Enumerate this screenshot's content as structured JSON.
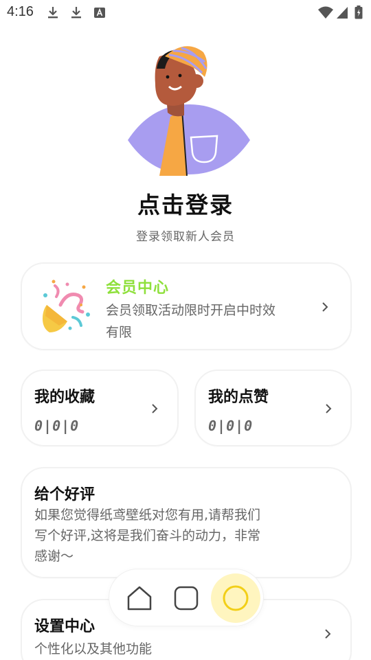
{
  "status_bar": {
    "time": "4:16",
    "icons": [
      "download-icon",
      "download-icon",
      "font-icon",
      "wifi-icon",
      "signal-icon",
      "battery-icon"
    ]
  },
  "profile": {
    "title": "点击登录",
    "subtitle": "登录领取新人会员"
  },
  "member_card": {
    "title": "会员中心",
    "description": "会员领取活动限时开启中时效有限",
    "title_color": "#8fe03c"
  },
  "stats": [
    {
      "title": "我的收藏",
      "value": "0|0|0"
    },
    {
      "title": "我的点赞",
      "value": "0|0|0"
    }
  ],
  "review_card": {
    "title": "给个好评",
    "description": "如果您觉得纸鸢壁纸对您有用,请帮我们写个好评,这将是我们奋斗的动力，非常感谢～"
  },
  "settings_card": {
    "title": "设置中心",
    "description": "个性化以及其他功能"
  },
  "bottom_nav": {
    "items": [
      "home-icon",
      "square-icon",
      "circle-icon"
    ],
    "active_color": "#fff5bf"
  }
}
